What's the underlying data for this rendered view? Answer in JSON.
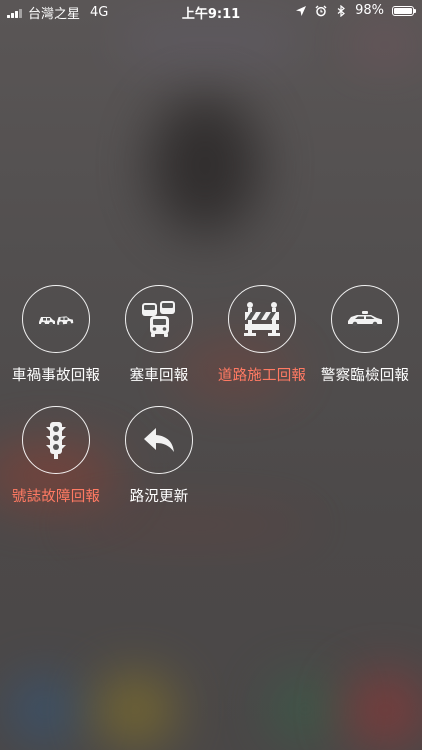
{
  "status_bar": {
    "carrier": "台灣之星",
    "network": "4G",
    "time": "上午9:11",
    "battery": "98%",
    "battery_level": 0.98
  },
  "icons": {
    "signal": "signal-strength-icon",
    "location": "location-arrow-icon",
    "alarm": "alarm-clock-icon",
    "bluetooth": "bluetooth-icon",
    "battery": "battery-icon"
  },
  "colors": {
    "accent_text": "#ff7a63",
    "label_text": "#ffffff"
  },
  "reports": [
    {
      "label": "車禍事故回報",
      "icon": "car-collision-icon",
      "accent": false
    },
    {
      "label": "塞車回報",
      "icon": "traffic-jam-icon",
      "accent": false
    },
    {
      "label": "道路施工回報",
      "icon": "road-barrier-icon",
      "accent": true
    },
    {
      "label": "警察臨檢回報",
      "icon": "police-car-icon",
      "accent": false
    },
    {
      "label": "號誌故障回報",
      "icon": "traffic-light-icon",
      "accent": true
    },
    {
      "label": "路況更新",
      "icon": "reply-arrow-icon",
      "accent": false
    }
  ]
}
